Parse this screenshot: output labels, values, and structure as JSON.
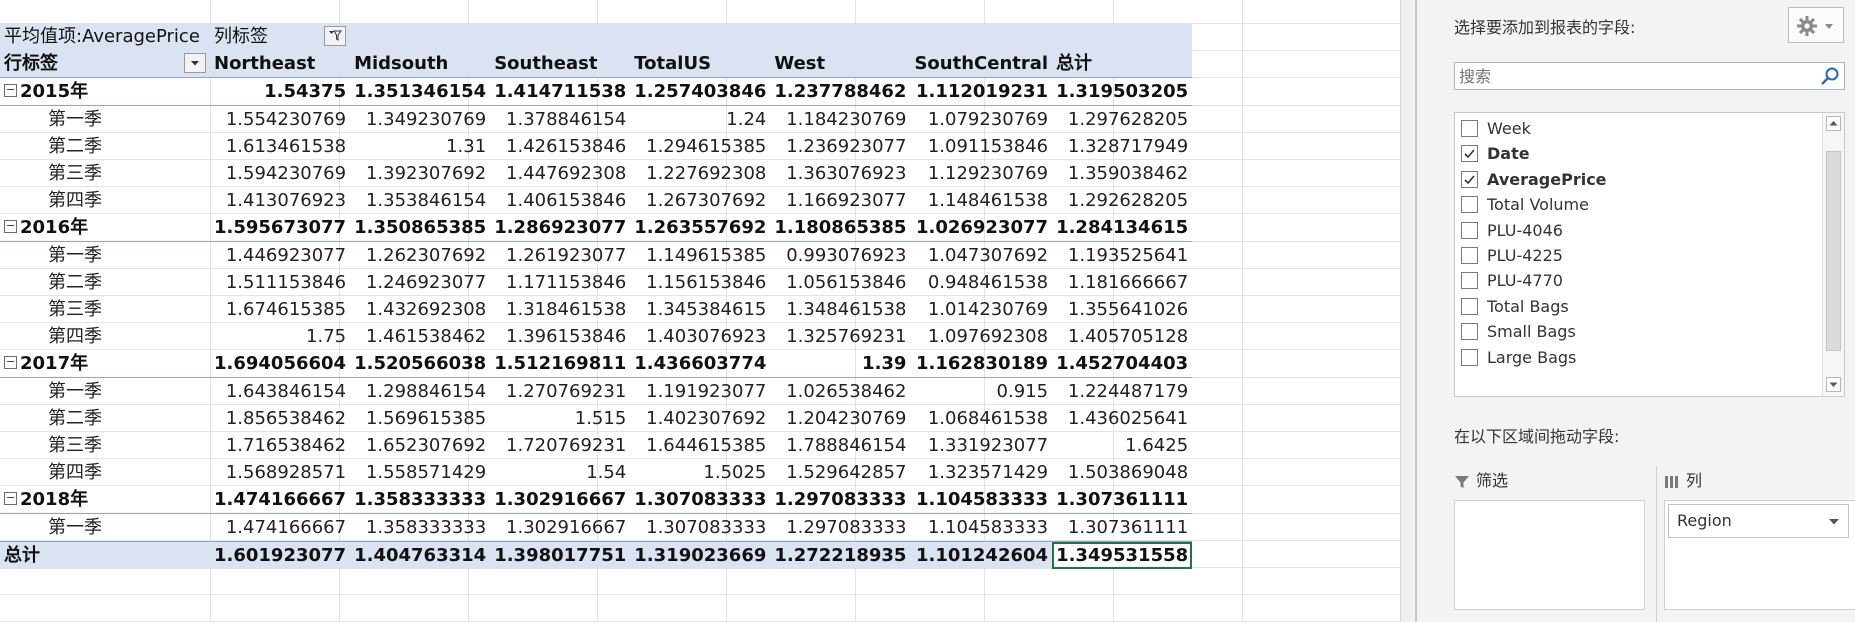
{
  "pivot": {
    "value_field": "平均值项:AveragePrice",
    "col_label": "列标签",
    "row_label": "行标签",
    "columns": [
      "Northeast",
      "Midsouth",
      "Southeast",
      "TotalUS",
      "West",
      "SouthCentral",
      "总计"
    ],
    "rows": [
      {
        "level": "year",
        "label": "2015年",
        "values": [
          "1.54375",
          "1.351346154",
          "1.414711538",
          "1.257403846",
          "1.237788462",
          "1.112019231",
          "1.319503205"
        ]
      },
      {
        "level": "quarter",
        "label": "第一季",
        "values": [
          "1.554230769",
          "1.349230769",
          "1.378846154",
          "1.24",
          "1.184230769",
          "1.079230769",
          "1.297628205"
        ]
      },
      {
        "level": "quarter",
        "label": "第二季",
        "values": [
          "1.613461538",
          "1.31",
          "1.426153846",
          "1.294615385",
          "1.236923077",
          "1.091153846",
          "1.328717949"
        ]
      },
      {
        "level": "quarter",
        "label": "第三季",
        "values": [
          "1.594230769",
          "1.392307692",
          "1.447692308",
          "1.227692308",
          "1.363076923",
          "1.129230769",
          "1.359038462"
        ]
      },
      {
        "level": "quarter",
        "label": "第四季",
        "values": [
          "1.413076923",
          "1.353846154",
          "1.406153846",
          "1.267307692",
          "1.166923077",
          "1.148461538",
          "1.292628205"
        ]
      },
      {
        "level": "year",
        "label": "2016年",
        "values": [
          "1.595673077",
          "1.350865385",
          "1.286923077",
          "1.263557692",
          "1.180865385",
          "1.026923077",
          "1.284134615"
        ]
      },
      {
        "level": "quarter",
        "label": "第一季",
        "values": [
          "1.446923077",
          "1.262307692",
          "1.261923077",
          "1.149615385",
          "0.993076923",
          "1.047307692",
          "1.193525641"
        ]
      },
      {
        "level": "quarter",
        "label": "第二季",
        "values": [
          "1.511153846",
          "1.246923077",
          "1.171153846",
          "1.156153846",
          "1.056153846",
          "0.948461538",
          "1.181666667"
        ]
      },
      {
        "level": "quarter",
        "label": "第三季",
        "values": [
          "1.674615385",
          "1.432692308",
          "1.318461538",
          "1.345384615",
          "1.348461538",
          "1.014230769",
          "1.355641026"
        ]
      },
      {
        "level": "quarter",
        "label": "第四季",
        "values": [
          "1.75",
          "1.461538462",
          "1.396153846",
          "1.403076923",
          "1.325769231",
          "1.097692308",
          "1.405705128"
        ]
      },
      {
        "level": "year",
        "label": "2017年",
        "values": [
          "1.694056604",
          "1.520566038",
          "1.512169811",
          "1.436603774",
          "1.39",
          "1.162830189",
          "1.452704403"
        ]
      },
      {
        "level": "quarter",
        "label": "第一季",
        "values": [
          "1.643846154",
          "1.298846154",
          "1.270769231",
          "1.191923077",
          "1.026538462",
          "0.915",
          "1.224487179"
        ]
      },
      {
        "level": "quarter",
        "label": "第二季",
        "values": [
          "1.856538462",
          "1.569615385",
          "1.515",
          "1.402307692",
          "1.204230769",
          "1.068461538",
          "1.436025641"
        ]
      },
      {
        "level": "quarter",
        "label": "第三季",
        "values": [
          "1.716538462",
          "1.652307692",
          "1.720769231",
          "1.644615385",
          "1.788846154",
          "1.331923077",
          "1.6425"
        ]
      },
      {
        "level": "quarter",
        "label": "第四季",
        "values": [
          "1.568928571",
          "1.558571429",
          "1.54",
          "1.5025",
          "1.529642857",
          "1.323571429",
          "1.503869048"
        ]
      },
      {
        "level": "year",
        "label": "2018年",
        "values": [
          "1.474166667",
          "1.358333333",
          "1.302916667",
          "1.307083333",
          "1.297083333",
          "1.104583333",
          "1.307361111"
        ]
      },
      {
        "level": "quarter",
        "label": "第一季",
        "values": [
          "1.474166667",
          "1.358333333",
          "1.302916667",
          "1.307083333",
          "1.297083333",
          "1.104583333",
          "1.307361111"
        ]
      }
    ],
    "grand_total": {
      "label": "总计",
      "values": [
        "1.601923077",
        "1.404763314",
        "1.398017751",
        "1.319023669",
        "1.272218935",
        "1.101242604",
        "1.349531558"
      ]
    }
  },
  "field_pane": {
    "title": "选择要添加到报表的字段:",
    "search_placeholder": "搜索",
    "fields": [
      {
        "name": "Week",
        "checked": false
      },
      {
        "name": "Date",
        "checked": true
      },
      {
        "name": "AveragePrice",
        "checked": true
      },
      {
        "name": "Total Volume",
        "checked": false
      },
      {
        "name": "PLU-4046",
        "checked": false
      },
      {
        "name": "PLU-4225",
        "checked": false
      },
      {
        "name": "PLU-4770",
        "checked": false
      },
      {
        "name": "Total Bags",
        "checked": false
      },
      {
        "name": "Small Bags",
        "checked": false
      },
      {
        "name": "Large Bags",
        "checked": false
      }
    ],
    "drag_title": "在以下区域间拖动字段:",
    "filter_label": "筛选",
    "columns_label": "列",
    "column_fields": [
      "Region"
    ]
  },
  "colors": {
    "header_fill": "#dbe2f1",
    "border_blue": "#8ea5d2",
    "selection": "#217346"
  }
}
